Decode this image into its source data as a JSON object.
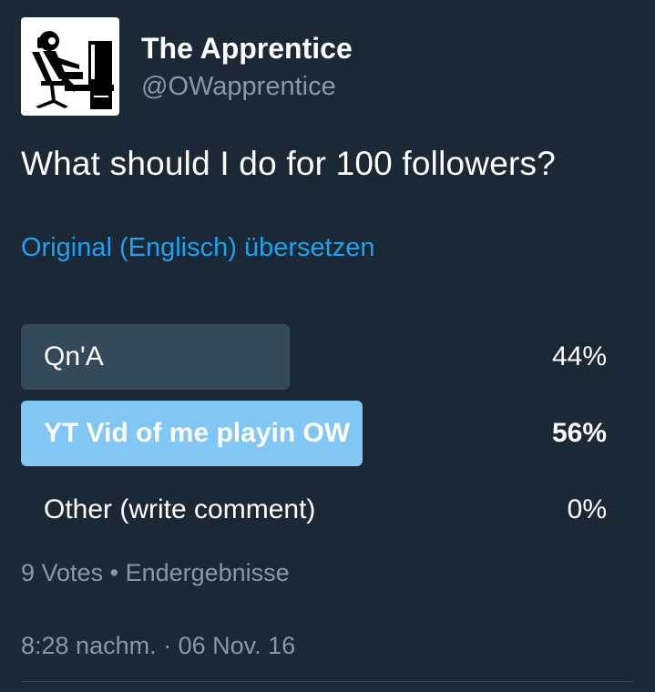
{
  "author": {
    "display_name": "The Apprentice",
    "handle": "@OWapprentice",
    "avatar_icon": "gamer-at-desk-icon"
  },
  "tweet": {
    "text": "What should I do for 100 followers?",
    "translate_link": "Original (Englisch) übersetzen"
  },
  "poll": {
    "options": [
      {
        "label": "Qn'A",
        "percent_text": "44%",
        "percent": 44,
        "winner": false
      },
      {
        "label": "YT Vid of me playin OW",
        "percent_text": "56%",
        "percent": 56,
        "winner": true
      },
      {
        "label": "Other (write comment)",
        "percent_text": "0%",
        "percent": 0,
        "winner": false
      }
    ],
    "votes": "9 Votes",
    "separator": "•",
    "status": "Endergebnisse"
  },
  "timestamp": {
    "time": "8:28 nachm.",
    "separator": "·",
    "date": "06 Nov. 16"
  },
  "colors": {
    "background": "#1b2836",
    "accent": "#1da1f2",
    "winner_bar": "#80c7f5",
    "normal_bar": "#34495a",
    "secondary_text": "#8899a6"
  }
}
